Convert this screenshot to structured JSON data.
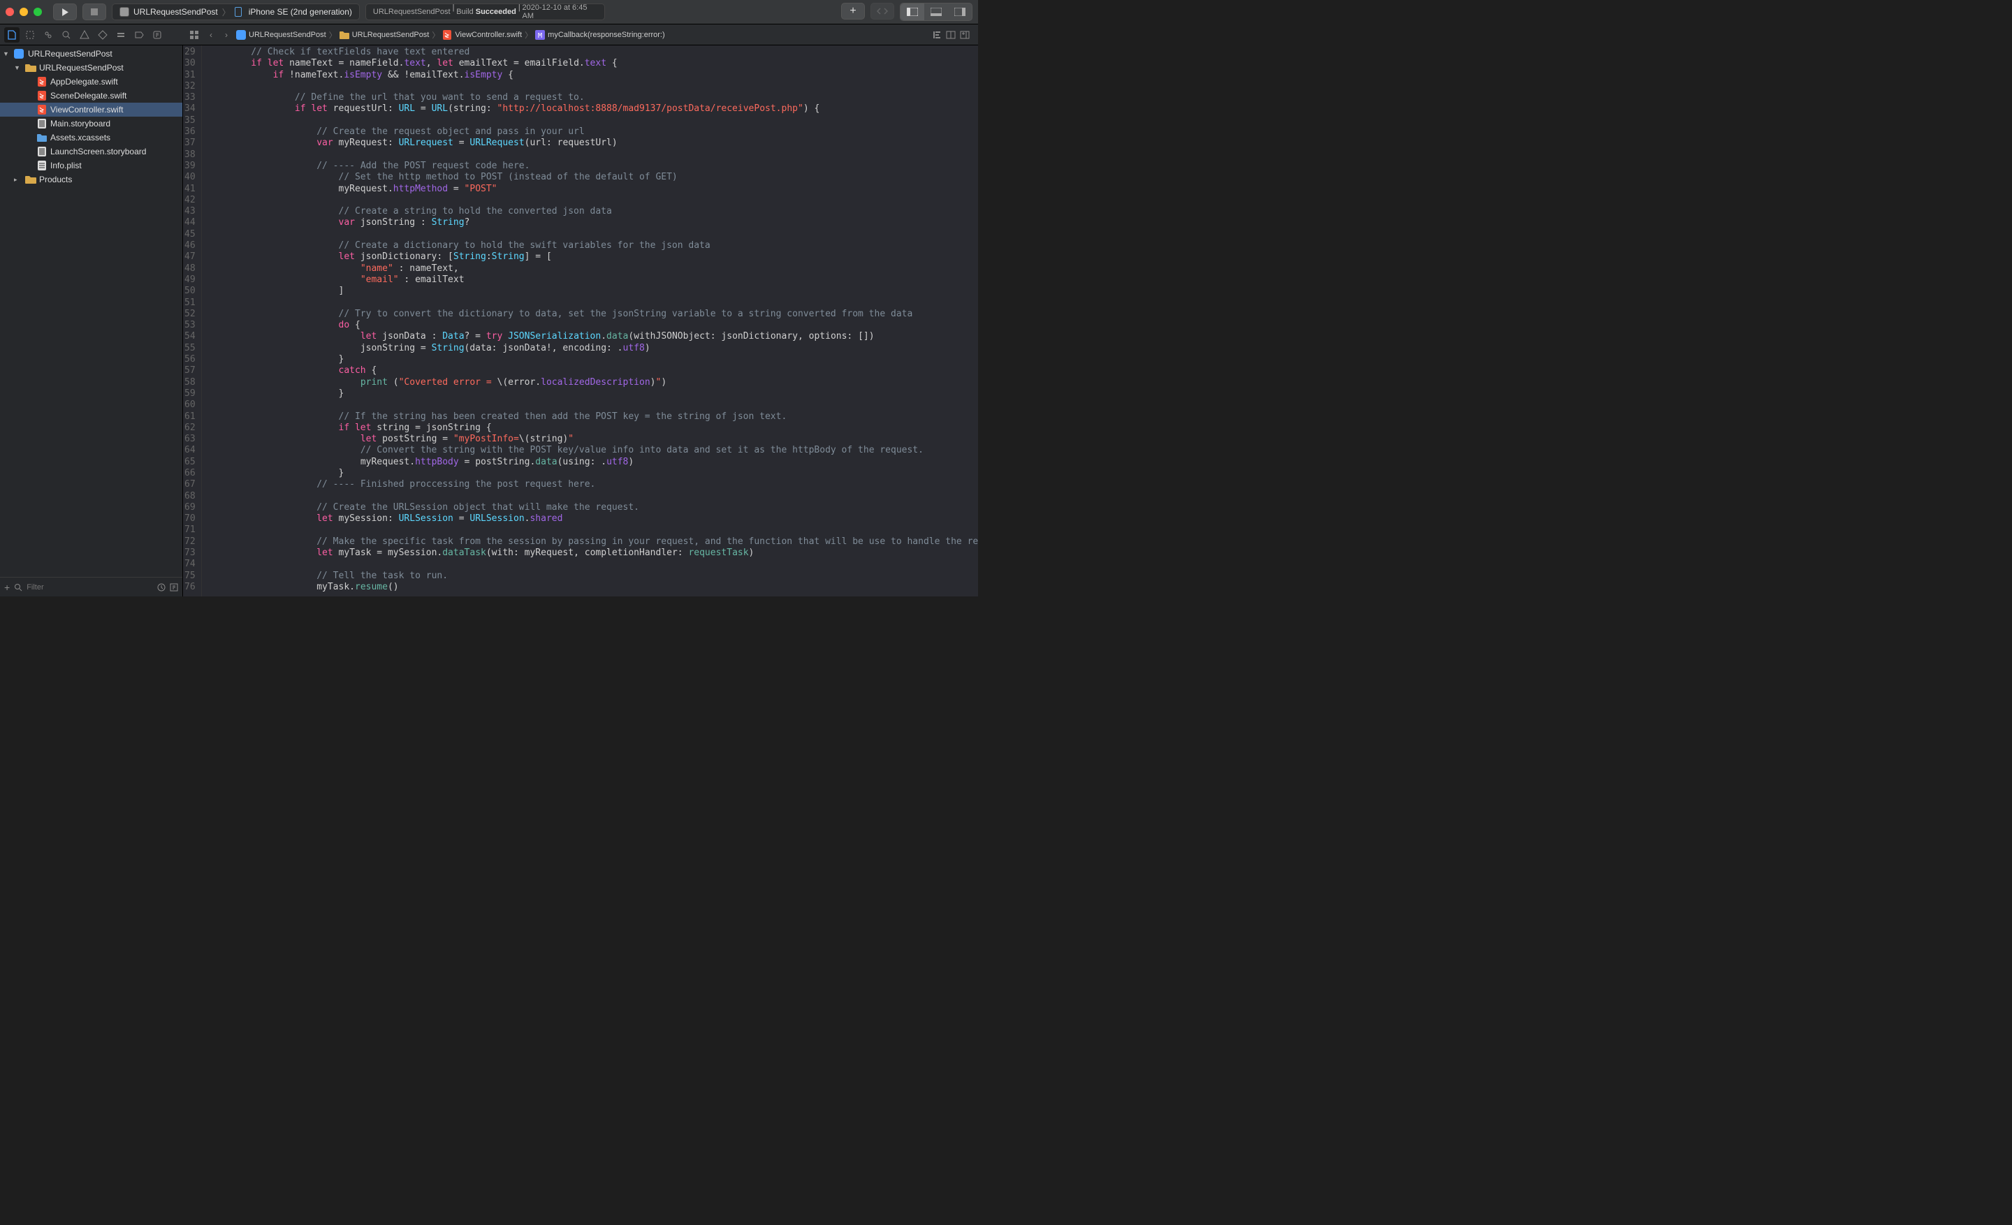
{
  "titlebar": {
    "scheme": "URLRequestSendPost",
    "device": "iPhone SE (2nd generation)",
    "status_project": "URLRequestSendPost",
    "status_build_label": "Build",
    "status_build_result": "Succeeded",
    "status_time": "2020-12-10 at 6:45 AM"
  },
  "breadcrumb": {
    "items": [
      {
        "icon": "app",
        "label": "URLRequestSendPost"
      },
      {
        "icon": "folder",
        "label": "URLRequestSendPost"
      },
      {
        "icon": "swift",
        "label": "ViewController.swift"
      },
      {
        "icon": "method",
        "label": "myCallback(responseString:error:)"
      }
    ]
  },
  "navigator": {
    "root": "URLRequestSendPost",
    "group": "URLRequestSendPost",
    "files": [
      {
        "name": "AppDelegate.swift",
        "icon": "swift"
      },
      {
        "name": "SceneDelegate.swift",
        "icon": "swift"
      },
      {
        "name": "ViewController.swift",
        "icon": "swift",
        "selected": true
      },
      {
        "name": "Main.storyboard",
        "icon": "storyboard"
      },
      {
        "name": "Assets.xcassets",
        "icon": "assets"
      },
      {
        "name": "LaunchScreen.storyboard",
        "icon": "storyboard"
      },
      {
        "name": "Info.plist",
        "icon": "plist"
      }
    ],
    "products": "Products",
    "filter_placeholder": "Filter"
  },
  "editor": {
    "first_line": 29,
    "lines": [
      {
        "indent": 8,
        "tokens": [
          [
            "c-comment",
            "// Check if textFields have text entered"
          ]
        ]
      },
      {
        "indent": 8,
        "tokens": [
          [
            "c-kw",
            "if let"
          ],
          [
            "",
            " nameText = nameField."
          ],
          [
            "c-prop",
            "text"
          ],
          [
            "",
            ", "
          ],
          [
            "c-kw",
            "let"
          ],
          [
            "",
            " emailText = emailField."
          ],
          [
            "c-prop",
            "text"
          ],
          [
            "",
            " {"
          ]
        ]
      },
      {
        "indent": 12,
        "tokens": [
          [
            "c-kw",
            "if"
          ],
          [
            "",
            " !nameText."
          ],
          [
            "c-prop",
            "isEmpty"
          ],
          [
            "",
            " && !emailText."
          ],
          [
            "c-prop",
            "isEmpty"
          ],
          [
            "",
            " {"
          ]
        ]
      },
      {
        "indent": 0,
        "tokens": [
          [
            "",
            ""
          ]
        ]
      },
      {
        "indent": 16,
        "tokens": [
          [
            "c-comment",
            "// Define the url that you want to send a request to."
          ]
        ]
      },
      {
        "indent": 16,
        "tokens": [
          [
            "c-kw",
            "if let"
          ],
          [
            "",
            " requestUrl: "
          ],
          [
            "c-type",
            "URL"
          ],
          [
            "",
            " = "
          ],
          [
            "c-type",
            "URL"
          ],
          [
            "",
            "(string: "
          ],
          [
            "c-str",
            "\"http://localhost:8888/mad9137/postData/receivePost.php\""
          ],
          [
            "",
            ") {"
          ]
        ]
      },
      {
        "indent": 0,
        "tokens": [
          [
            "",
            ""
          ]
        ]
      },
      {
        "indent": 20,
        "tokens": [
          [
            "c-comment",
            "// Create the request object and pass in your url"
          ]
        ]
      },
      {
        "indent": 20,
        "tokens": [
          [
            "c-kw",
            "var"
          ],
          [
            "",
            " myRequest: "
          ],
          [
            "c-type",
            "URLrequest"
          ],
          [
            "",
            " = "
          ],
          [
            "c-type",
            "URLRequest"
          ],
          [
            "",
            "(url: requestUrl)"
          ]
        ]
      },
      {
        "indent": 0,
        "tokens": [
          [
            "",
            ""
          ]
        ]
      },
      {
        "indent": 20,
        "tokens": [
          [
            "c-comment",
            "// ---- Add the POST request code here."
          ]
        ]
      },
      {
        "indent": 24,
        "tokens": [
          [
            "c-comment",
            "// Set the http method to POST (instead of the default of GET)"
          ]
        ]
      },
      {
        "indent": 24,
        "tokens": [
          [
            "",
            "myRequest."
          ],
          [
            "c-prop",
            "httpMethod"
          ],
          [
            "",
            " = "
          ],
          [
            "c-str",
            "\"POST\""
          ]
        ]
      },
      {
        "indent": 0,
        "tokens": [
          [
            "",
            ""
          ]
        ]
      },
      {
        "indent": 24,
        "tokens": [
          [
            "c-comment",
            "// Create a string to hold the converted json data"
          ]
        ]
      },
      {
        "indent": 24,
        "tokens": [
          [
            "c-kw",
            "var"
          ],
          [
            "",
            " jsonString : "
          ],
          [
            "c-type",
            "String"
          ],
          [
            "",
            "?"
          ]
        ]
      },
      {
        "indent": 0,
        "tokens": [
          [
            "",
            ""
          ]
        ]
      },
      {
        "indent": 24,
        "tokens": [
          [
            "c-comment",
            "// Create a dictionary to hold the swift variables for the json data"
          ]
        ]
      },
      {
        "indent": 24,
        "tokens": [
          [
            "c-kw",
            "let"
          ],
          [
            "",
            " jsonDictionary: ["
          ],
          [
            "c-type",
            "String"
          ],
          [
            "",
            ":"
          ],
          [
            "c-type",
            "String"
          ],
          [
            "",
            "] = ["
          ]
        ]
      },
      {
        "indent": 28,
        "tokens": [
          [
            "c-str",
            "\"name\""
          ],
          [
            "",
            " : nameText,"
          ]
        ]
      },
      {
        "indent": 28,
        "tokens": [
          [
            "c-str",
            "\"email\""
          ],
          [
            "",
            " : emailText"
          ]
        ]
      },
      {
        "indent": 24,
        "tokens": [
          [
            "",
            "]"
          ]
        ]
      },
      {
        "indent": 0,
        "tokens": [
          [
            "",
            ""
          ]
        ]
      },
      {
        "indent": 24,
        "tokens": [
          [
            "c-comment",
            "// Try to convert the dictionary to data, set the jsonString variable to a string converted from the data"
          ]
        ]
      },
      {
        "indent": 24,
        "tokens": [
          [
            "c-kw",
            "do"
          ],
          [
            "",
            " {"
          ]
        ]
      },
      {
        "indent": 28,
        "tokens": [
          [
            "c-kw",
            "let"
          ],
          [
            "",
            " jsonData : "
          ],
          [
            "c-type",
            "Data"
          ],
          [
            "",
            "? = "
          ],
          [
            "c-kw",
            "try"
          ],
          [
            "",
            " "
          ],
          [
            "c-type",
            "JSONSerialization"
          ],
          [
            "",
            "."
          ],
          [
            "c-call",
            "data"
          ],
          [
            "",
            "(withJSONObject: jsonDictionary, options: [])"
          ]
        ]
      },
      {
        "indent": 28,
        "tokens": [
          [
            "",
            "jsonString = "
          ],
          [
            "c-type",
            "String"
          ],
          [
            "",
            "(data: jsonData!, encoding: ."
          ],
          [
            "c-prop",
            "utf8"
          ],
          [
            "",
            ")"
          ]
        ]
      },
      {
        "indent": 24,
        "tokens": [
          [
            "",
            "}"
          ]
        ]
      },
      {
        "indent": 24,
        "tokens": [
          [
            "c-kw",
            "catch"
          ],
          [
            "",
            " {"
          ]
        ]
      },
      {
        "indent": 28,
        "tokens": [
          [
            "c-call",
            "print"
          ],
          [
            "",
            " ("
          ],
          [
            "c-str",
            "\"Coverted error = "
          ],
          [
            "",
            "\\(error."
          ],
          [
            "c-prop",
            "localizedDescription"
          ],
          [
            "",
            ")"
          ],
          [
            "c-str",
            "\""
          ],
          [
            "",
            ")"
          ]
        ]
      },
      {
        "indent": 24,
        "tokens": [
          [
            "",
            "}"
          ]
        ]
      },
      {
        "indent": 0,
        "tokens": [
          [
            "",
            ""
          ]
        ]
      },
      {
        "indent": 24,
        "tokens": [
          [
            "c-comment",
            "// If the string has been created then add the POST key = the string of json text."
          ]
        ]
      },
      {
        "indent": 24,
        "tokens": [
          [
            "c-kw",
            "if let"
          ],
          [
            "",
            " string = jsonString {"
          ]
        ]
      },
      {
        "indent": 28,
        "tokens": [
          [
            "c-kw",
            "let"
          ],
          [
            "",
            " postString = "
          ],
          [
            "c-str",
            "\"myPostInfo="
          ],
          [
            "",
            "\\(string)"
          ],
          [
            "c-str",
            "\""
          ]
        ]
      },
      {
        "indent": 28,
        "tokens": [
          [
            "c-comment",
            "// Convert the string with the POST key/value info into data and set it as the httpBody of the request."
          ]
        ]
      },
      {
        "indent": 28,
        "tokens": [
          [
            "",
            "myRequest."
          ],
          [
            "c-prop",
            "httpBody"
          ],
          [
            "",
            " = postString."
          ],
          [
            "c-call",
            "data"
          ],
          [
            "",
            "(using: ."
          ],
          [
            "c-prop",
            "utf8"
          ],
          [
            "",
            ")"
          ]
        ]
      },
      {
        "indent": 24,
        "tokens": [
          [
            "",
            "}"
          ]
        ]
      },
      {
        "indent": 20,
        "tokens": [
          [
            "c-comment",
            "// ---- Finished proccessing the post request here."
          ]
        ]
      },
      {
        "indent": 0,
        "tokens": [
          [
            "",
            ""
          ]
        ]
      },
      {
        "indent": 20,
        "tokens": [
          [
            "c-comment",
            "// Create the URLSession object that will make the request."
          ]
        ]
      },
      {
        "indent": 20,
        "tokens": [
          [
            "c-kw",
            "let"
          ],
          [
            "",
            " mySession: "
          ],
          [
            "c-type",
            "URLSession"
          ],
          [
            "",
            " = "
          ],
          [
            "c-type",
            "URLSession"
          ],
          [
            "",
            "."
          ],
          [
            "c-prop",
            "shared"
          ]
        ]
      },
      {
        "indent": 0,
        "tokens": [
          [
            "",
            ""
          ]
        ]
      },
      {
        "indent": 20,
        "tokens": [
          [
            "c-comment",
            "// Make the specific task from the session by passing in your request, and the function that will be use to handle the request."
          ]
        ]
      },
      {
        "indent": 20,
        "tokens": [
          [
            "c-kw",
            "let"
          ],
          [
            "",
            " myTask = mySession."
          ],
          [
            "c-call",
            "dataTask"
          ],
          [
            "",
            "(with: myRequest, completionHandler: "
          ],
          [
            "c-mint",
            "requestTask"
          ],
          [
            "",
            ")"
          ]
        ]
      },
      {
        "indent": 0,
        "tokens": [
          [
            "",
            ""
          ]
        ]
      },
      {
        "indent": 20,
        "tokens": [
          [
            "c-comment",
            "// Tell the task to run."
          ]
        ]
      },
      {
        "indent": 20,
        "tokens": [
          [
            "",
            "myTask."
          ],
          [
            "c-call",
            "resume"
          ],
          [
            "",
            "()"
          ]
        ]
      }
    ]
  }
}
